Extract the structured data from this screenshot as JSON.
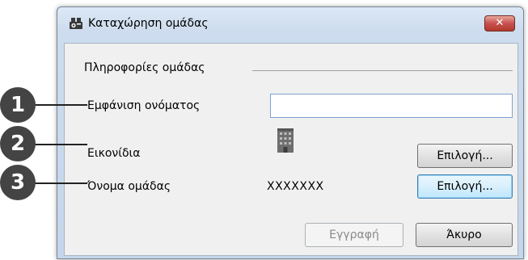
{
  "window": {
    "title": "Καταχώρηση ομάδας",
    "close_label": "✕"
  },
  "group": {
    "title": "Πληροφορίες ομάδας"
  },
  "fields": {
    "display_name_label": "Εμφάνιση ονόματος",
    "display_name_value": "",
    "icon_label": "Εικονίδια",
    "group_name_label": "Όνομα ομάδας",
    "group_name_value": "XXXXXXX"
  },
  "buttons": {
    "select_icon": "Επιλογή...",
    "select_group": "Επιλογή...",
    "register": "Εγγραφή",
    "cancel": "Άκυρο"
  },
  "callouts": [
    "1",
    "2",
    "3"
  ],
  "colors": {
    "title_bar": "#cddcee",
    "client_bg": "#f0f0f0",
    "close_button": "#c75050",
    "callout": "#444444"
  }
}
